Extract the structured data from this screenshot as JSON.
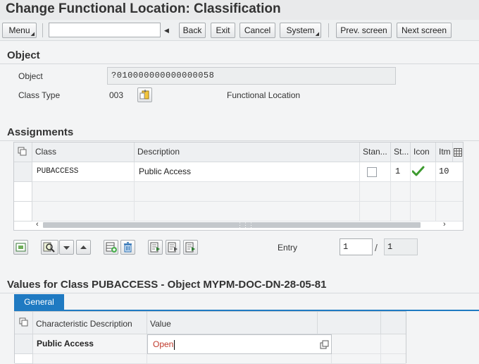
{
  "title": "Change Functional Location: Classification",
  "toolbar": {
    "menu": "Menu",
    "command_value": "",
    "back": "Back",
    "exit": "Exit",
    "cancel": "Cancel",
    "system": "System",
    "prev_screen": "Prev. screen",
    "next_screen": "Next screen"
  },
  "object_section": {
    "title": "Object",
    "object_label": "Object",
    "object_value": "?010000000000000058",
    "class_type_label": "Class Type",
    "class_type_value": "003",
    "class_type_text": "Functional Location"
  },
  "assignments": {
    "title": "Assignments",
    "columns": [
      "Class",
      "Description",
      "Stan...",
      "St...",
      "Icon",
      "Itm"
    ],
    "rows": [
      {
        "class": "PUBACCESS",
        "description": "Public Access",
        "standard": false,
        "status": "1",
        "icon": "checkmark-icon",
        "item": "10"
      }
    ],
    "entry_label": "Entry",
    "entry_current": "1",
    "entry_separator": "/",
    "entry_total": "1"
  },
  "values": {
    "title": "Values for Class PUBACCESS - Object MYPM-DOC-DN-28-05-81",
    "tab_general": "General",
    "columns": [
      "Characteristic Description",
      "Value"
    ],
    "rows": [
      {
        "description": "Public Access",
        "value": "Open"
      }
    ]
  },
  "colors": {
    "accent": "#1f7ac2",
    "value_text": "#c0392b",
    "checkmark": "#3d9a2f"
  }
}
